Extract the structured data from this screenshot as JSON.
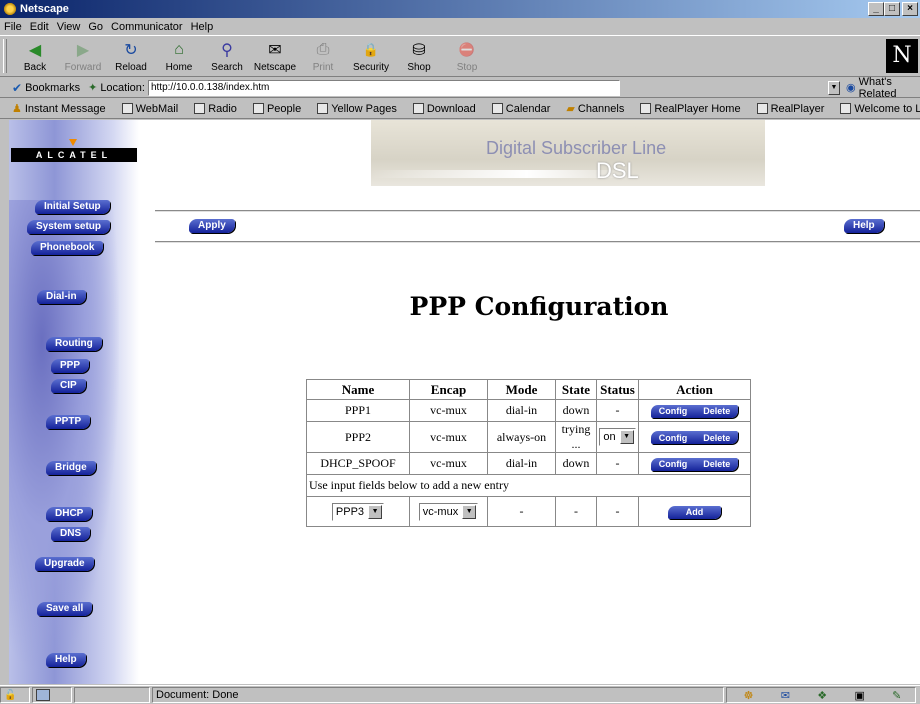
{
  "window": {
    "title": "Netscape",
    "minimize": "_",
    "maximize": "□",
    "close": "×"
  },
  "menu": [
    "File",
    "Edit",
    "View",
    "Go",
    "Communicator",
    "Help"
  ],
  "toolbar": {
    "buttons": [
      {
        "label": "Back",
        "icon": "◀"
      },
      {
        "label": "Forward",
        "icon": "▶"
      },
      {
        "label": "Reload",
        "icon": "↻"
      },
      {
        "label": "Home",
        "icon": "⌂"
      },
      {
        "label": "Search",
        "icon": "⚲"
      },
      {
        "label": "Netscape",
        "icon": "✉"
      },
      {
        "label": "Print",
        "icon": "⎙"
      },
      {
        "label": "Security",
        "icon": "🔒"
      },
      {
        "label": "Shop",
        "icon": "⛁"
      },
      {
        "label": "Stop",
        "icon": "⛔"
      }
    ],
    "logo": "N"
  },
  "location": {
    "bookmarks_label": "Bookmarks",
    "location_label": "Location:",
    "url": "http://10.0.0.138/index.htm",
    "whats_related": "What's Related"
  },
  "personal_bar": [
    "Instant Message",
    "WebMail",
    "Radio",
    "People",
    "Yellow Pages",
    "Download",
    "Calendar",
    "Channels",
    "RealPlayer Home",
    "RealPlayer",
    "Welcome to Li"
  ],
  "page": {
    "brand": "ALCATEL",
    "banner_line1": "Digital Subscriber Line",
    "banner_line2": "DSL",
    "apply_label": "Apply",
    "help_label": "Help",
    "heading": "PPP Configuration",
    "nav": [
      "Initial Setup",
      "System setup",
      "Phonebook",
      "Dial-in",
      "Routing",
      "PPP",
      "CIP",
      "PPTP",
      "Bridge",
      "DHCP",
      "DNS",
      "Upgrade",
      "Save all",
      "Help"
    ]
  },
  "table": {
    "headers": [
      "Name",
      "Encap",
      "Mode",
      "State",
      "Status",
      "Action"
    ],
    "rows": [
      {
        "name": "PPP1",
        "encap": "vc-mux",
        "mode": "dial-in",
        "state": "down",
        "status": "-",
        "config": "Config",
        "delete": "Delete"
      },
      {
        "name": "PPP2",
        "encap": "vc-mux",
        "mode": "always-on",
        "state": "trying ...",
        "status": "on",
        "config": "Config",
        "delete": "Delete"
      },
      {
        "name": "DHCP_SPOOF",
        "encap": "vc-mux",
        "mode": "dial-in",
        "state": "down",
        "status": "-",
        "config": "Config",
        "delete": "Delete"
      }
    ],
    "note": "Use input fields below to add a new entry",
    "new_entry": {
      "name": "PPP3",
      "encap": "vc-mux",
      "mode": "-",
      "state": "-",
      "status": "-",
      "add": "Add"
    }
  },
  "status_bar": {
    "text": "Document: Done"
  }
}
